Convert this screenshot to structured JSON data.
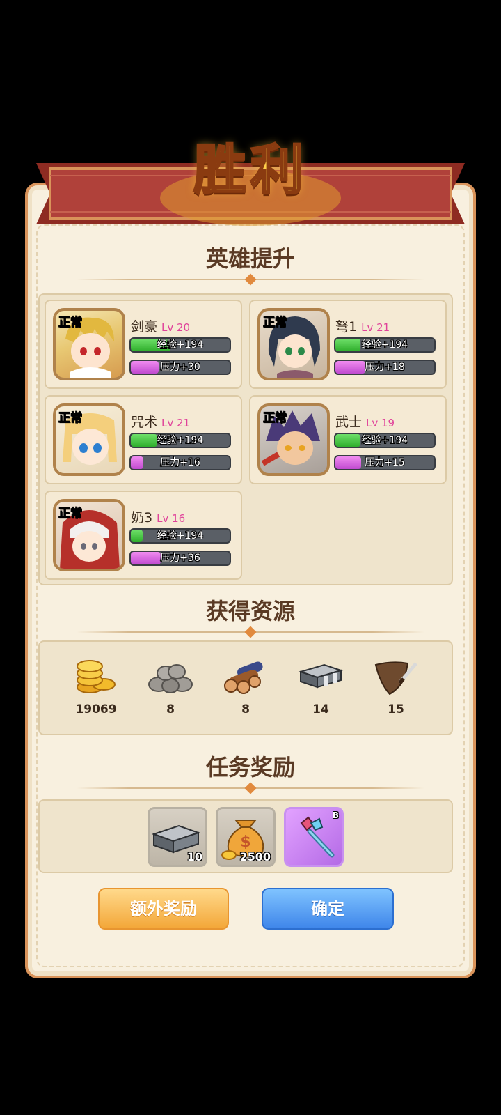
{
  "title": "胜利",
  "sections": {
    "heroes": "英雄提升",
    "resources": "获得资源",
    "quest": "任务奖励"
  },
  "heroes": [
    {
      "status": "正常",
      "name": "剑豪",
      "level": "Lv 20",
      "exp": "经验+194",
      "exp_fill": 0.4,
      "pressure": "压力+30",
      "pressure_fill": 0.28
    },
    {
      "status": "正常",
      "name": "弩1",
      "level": "Lv 21",
      "exp": "经验+194",
      "exp_fill": 0.25,
      "pressure": "压力+18",
      "pressure_fill": 0.3
    },
    {
      "status": "正常",
      "name": "咒术",
      "level": "Lv 21",
      "exp": "经验+194",
      "exp_fill": 0.27,
      "pressure": "压力+16",
      "pressure_fill": 0.13
    },
    {
      "status": "正常",
      "name": "武士",
      "level": "Lv 19",
      "exp": "经验+194",
      "exp_fill": 0.25,
      "pressure": "压力+15",
      "pressure_fill": 0.26
    },
    {
      "status": "正常",
      "name": "奶3",
      "level": "Lv 16",
      "exp": "经验+194",
      "exp_fill": 0.12,
      "pressure": "压力+36",
      "pressure_fill": 0.3
    }
  ],
  "resources": [
    {
      "icon": "gold-coins-icon",
      "value": "19069"
    },
    {
      "icon": "stone-icon",
      "value": "8"
    },
    {
      "icon": "wood-logs-icon",
      "value": "8"
    },
    {
      "icon": "iron-ingot-icon",
      "value": "14"
    },
    {
      "icon": "leather-icon",
      "value": "15"
    }
  ],
  "rewards": [
    {
      "icon": "iron-ingot-icon",
      "count": "10"
    },
    {
      "icon": "money-bag-icon",
      "count": "2500"
    },
    {
      "icon": "crystal-staff-icon",
      "count": "",
      "grade": "B"
    }
  ],
  "buttons": {
    "extra": "额外奖励",
    "confirm": "确定"
  },
  "colors": {
    "panel_bg": "#f8f0df",
    "banner_red": "#a83a2e",
    "title_gold": "#ffcf4a",
    "exp_green": "#2fae2c",
    "pressure_purple": "#c04ad0",
    "level_pink": "#e0429a",
    "button_orange": "#f3a739",
    "button_blue": "#3f86ea"
  }
}
